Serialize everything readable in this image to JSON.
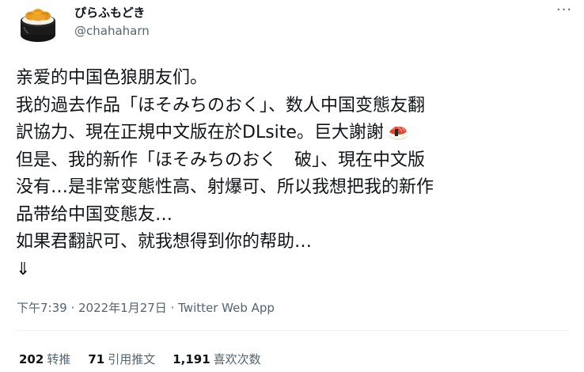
{
  "user": {
    "display_name": "ぴらふもどき",
    "handle": "@chahaharn",
    "avatar_icon": "sea-urchin-sushi-avatar"
  },
  "more_icon": "more-dots-icon",
  "more_label": "···",
  "tweet": {
    "lines": [
      "亲爱的中国色狼朋友们。",
      "我的過去作品「ほそみちのおく」、数人中国变態友翻",
      "訳協力、現在正規中文版在於DLsite。巨大謝謝",
      "但是、我的新作「ほそみちのおく　破」、現在中文版",
      "没有…是非常变態性高、射爆可、所以我想把我的新作",
      "品带给中国变態友…",
      "如果君翻訳可、就我想得到你的帮助…",
      "⇓"
    ],
    "emoji_icon": "sushi-icon"
  },
  "meta": {
    "time": "下午7:39",
    "sep1": " · ",
    "date": "2022年1月27日",
    "sep2": " · ",
    "app": "Twitter Web App"
  },
  "stats": [
    {
      "count": "202",
      "label": "转推"
    },
    {
      "count": "71",
      "label": "引用推文"
    },
    {
      "count": "1,191",
      "label": "喜欢次数"
    }
  ],
  "colors": {
    "text": "#0f1419",
    "secondary": "#536471",
    "divider": "#eff3f4"
  }
}
